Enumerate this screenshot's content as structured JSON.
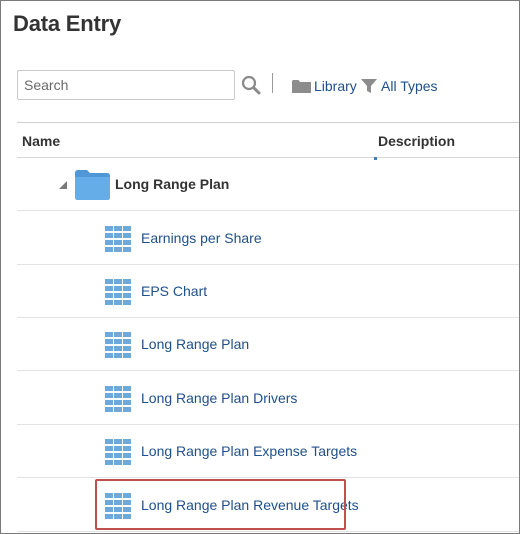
{
  "page": {
    "title": "Data Entry"
  },
  "search": {
    "placeholder": "Search",
    "value": ""
  },
  "toolbar": {
    "library_label": "Library",
    "types_label": "All Types"
  },
  "table": {
    "columns": {
      "name": "Name",
      "description": "Description"
    },
    "folder": {
      "label": "Long Range Plan",
      "expanded": true
    },
    "items": [
      {
        "label": "Earnings per Share",
        "description": ""
      },
      {
        "label": "EPS Chart",
        "description": ""
      },
      {
        "label": "Long Range Plan",
        "description": ""
      },
      {
        "label": "Long Range Plan Drivers",
        "description": ""
      },
      {
        "label": "Long Range Plan Expense Targets",
        "description": ""
      },
      {
        "label": "Long Range Plan Revenue Targets",
        "description": "",
        "highlighted": true
      }
    ]
  },
  "colors": {
    "link": "#20508b",
    "folder": "#5aa7e3",
    "grid_icon": "#6ea9dc",
    "highlight": "#c0504d",
    "text": "#333333"
  },
  "icons": {
    "search": "search-icon",
    "library": "folder-icon",
    "types": "filter-icon",
    "expand": "collapse-triangle-icon",
    "folder": "folder-icon",
    "form": "grid-icon"
  }
}
